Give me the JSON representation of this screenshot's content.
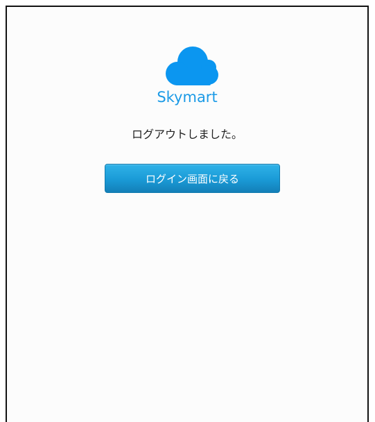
{
  "brand": {
    "name": "Skymart",
    "logo_icon": "cloud-icon",
    "color": "#1b9ae6"
  },
  "message": "ログアウトしました。",
  "back_button": {
    "label": "ログイン画面に戻る",
    "color": "#1a9ad6"
  }
}
